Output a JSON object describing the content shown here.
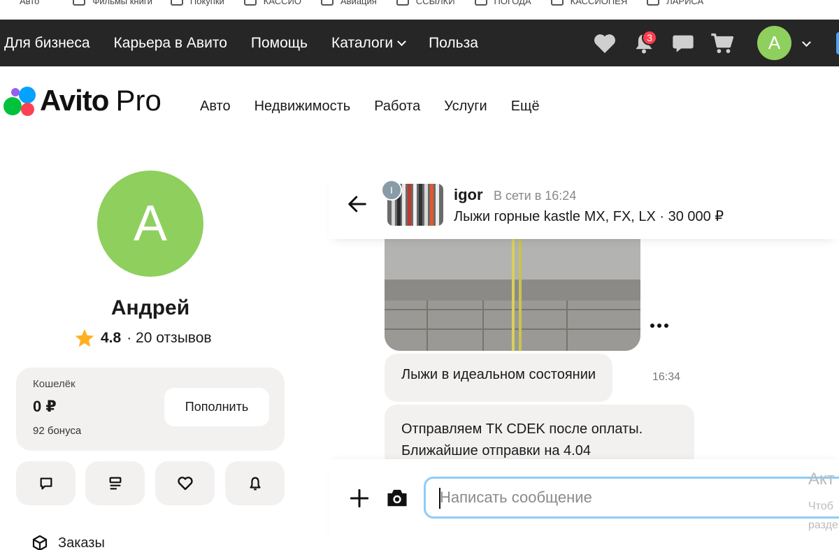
{
  "bookmarks": [
    "Авто",
    "Фильмы книги",
    "Покупки",
    "КАССИО",
    "Авиация",
    "ССЫЛКИ",
    "ПОГОДА",
    "КАССИОПЕЯ",
    "ЛАРИСА"
  ],
  "topnav": {
    "links": [
      "Для бизнеса",
      "Карьера в Авито",
      "Помощь",
      "Каталоги",
      "Польза"
    ],
    "notifications_count": "3",
    "avatar_letter": "А"
  },
  "logo": {
    "brand": "Avito",
    "suffix": "Pro"
  },
  "mainnav": [
    "Авто",
    "Недвижимость",
    "Работа",
    "Услуги",
    "Ещё"
  ],
  "profile": {
    "avatar_letter": "А",
    "name": "Андрей",
    "rating": "4.8",
    "reviews": "· 20 отзывов"
  },
  "wallet": {
    "label": "Кошелёк",
    "amount": "0 ₽",
    "bonus": "92 бонуса",
    "topup_label": "Пополнить"
  },
  "menu": {
    "orders": "Заказы"
  },
  "chat": {
    "seller_initial": "I",
    "seller_name": "igor",
    "seller_status": "В сети в 16:24",
    "item_title": "Лыжи горные kastle MX, FX, LX · 30 000 ₽",
    "messages": [
      {
        "text": "Лыжи в идеальном состоянии",
        "time": "16:34"
      },
      {
        "line1": "Отправляем ТК CDEK после оплаты.",
        "line2": "Ближайшие отправки на 4.04"
      }
    ]
  },
  "composer": {
    "placeholder": "Написать сообщение"
  },
  "side_panel": {
    "title": "Акт",
    "line1": "Чтоб",
    "line2": "разде"
  },
  "colors": {
    "accent_green": "#8fcf5e",
    "dark_nav": "#262626",
    "badge_red": "#ff3d4f",
    "input_focus": "#8ecdf7"
  }
}
